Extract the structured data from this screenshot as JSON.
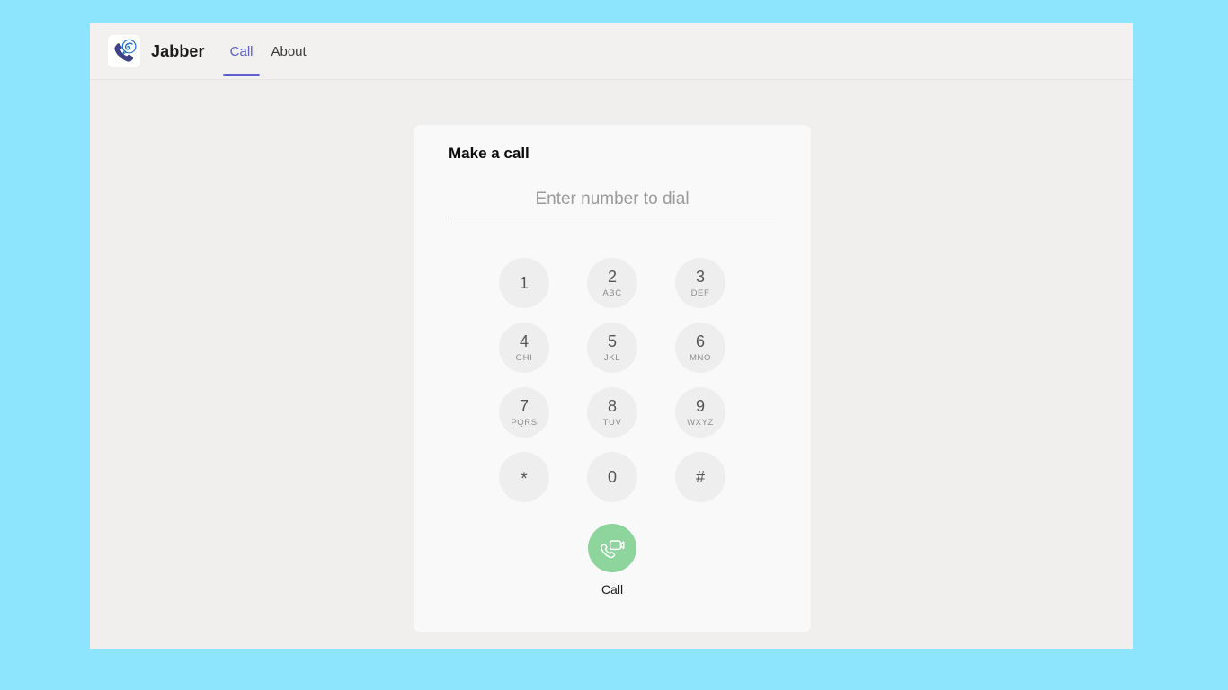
{
  "window": {
    "desktop_background_color": "#8ce4fd",
    "app_background_color": "#f1efee"
  },
  "header": {
    "logo_icon": "jabber-phone-chat-logo-icon",
    "app_title": "Jabber",
    "active_tab_color": "#5b5fc7",
    "tabs": [
      {
        "id": "call",
        "label": "Call",
        "active": true
      },
      {
        "id": "about",
        "label": "About",
        "active": false
      }
    ]
  },
  "card": {
    "title": "Make a call",
    "background_color": "#f9f9f9",
    "dial_input": {
      "value": "",
      "placeholder": "Enter number to dial"
    },
    "keypad": [
      {
        "digit": "1",
        "letters": ""
      },
      {
        "digit": "2",
        "letters": "ABC"
      },
      {
        "digit": "3",
        "letters": "DEF"
      },
      {
        "digit": "4",
        "letters": "GHI"
      },
      {
        "digit": "5",
        "letters": "JKL"
      },
      {
        "digit": "6",
        "letters": "MNO"
      },
      {
        "digit": "7",
        "letters": "PQRS"
      },
      {
        "digit": "8",
        "letters": "TUV"
      },
      {
        "digit": "9",
        "letters": "WXYZ"
      },
      {
        "digit": "*",
        "letters": ""
      },
      {
        "digit": "0",
        "letters": ""
      },
      {
        "digit": "#",
        "letters": ""
      }
    ],
    "call_action": {
      "icon": "video-call-icon",
      "label": "Call",
      "button_color": "#8ed49d"
    }
  }
}
